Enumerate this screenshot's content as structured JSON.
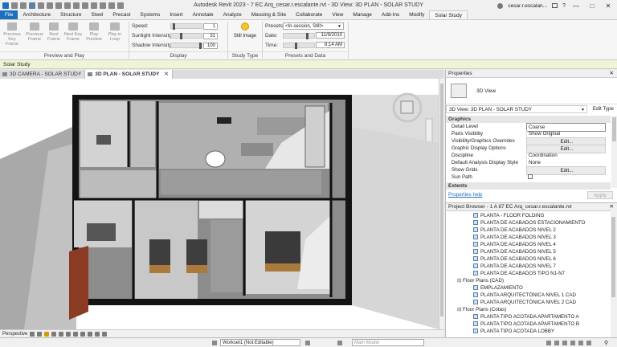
{
  "window": {
    "title": "Autodesk Revit 2023 - 7 EC Arq_cesar.r.escalante.rvt - 3D View: 3D PLAN - SOLAR STUDY",
    "user": "cesar.r.escalan...",
    "minimize": "—",
    "maximize": "□",
    "close": "✕"
  },
  "ribbon_tabs": [
    "File",
    "Architecture",
    "Structure",
    "Steel",
    "Precast",
    "Systems",
    "Insert",
    "Annotate",
    "Analyze",
    "Massing & Site",
    "Collaborate",
    "View",
    "Manage",
    "Add-Ins",
    "Modify",
    "Solar Study"
  ],
  "ribbon": {
    "play_buttons": [
      {
        "label": "Previous Key Frame"
      },
      {
        "label": "Previous Frame"
      },
      {
        "label": "Next Frame"
      },
      {
        "label": "Next Key Frame"
      },
      {
        "label": "Play Preview"
      },
      {
        "label": "Play in Loop"
      }
    ],
    "panel_preview": "Preview and Play",
    "display": {
      "speed_label": "Speed:",
      "speed_value": "1",
      "speed_level": 0.05,
      "sunlight_label": "Sunlight Intensity:",
      "sunlight_value": "31",
      "sunlight_level": 0.31,
      "shadow_label": "Shadow Intensity:",
      "shadow_value": "100",
      "shadow_level": 1.0
    },
    "panel_display": "Display",
    "still_image": "Still Image",
    "panel_study_type": "Study Type",
    "presets_label": "Presets:",
    "presets_value": "<In-session, Still>",
    "date_label": "Date:",
    "date_value": "11/9/2010",
    "time_label": "Time:",
    "time_value": "8:14 AM",
    "panel_presets": "Presets and Data"
  },
  "options_bar": {
    "text": "Solar Study"
  },
  "view_tabs": [
    {
      "label": "3D CAMERA - SOLAR STUDY",
      "active": false
    },
    {
      "label": "3D PLAN - SOLAR STUDY",
      "active": true
    }
  ],
  "view_control_bar": {
    "scale": "Perspective"
  },
  "status_bar": {
    "workset": "Workset1 (Not Editable)",
    "design_option": "Main Model"
  },
  "properties": {
    "title": "Properties",
    "type_name": "3D View",
    "instance_selector": "3D View: 3D PLAN - SOLAR STUDY",
    "edit_type": "Edit Type",
    "sections": {
      "graphics": "Graphics",
      "extents": "Extents"
    },
    "rows": [
      {
        "key": "Detail Level",
        "value": "Coarse",
        "kind": "input"
      },
      {
        "key": "Parts Visibility",
        "value": "Show Original",
        "kind": "text"
      },
      {
        "key": "Visibility/Graphics Overrides",
        "value": "Edit...",
        "kind": "button"
      },
      {
        "key": "Graphic Display Options",
        "value": "Edit...",
        "kind": "button"
      },
      {
        "key": "Discipline",
        "value": "Coordination",
        "kind": "text"
      },
      {
        "key": "Default Analysis Display Style",
        "value": "None",
        "kind": "text"
      },
      {
        "key": "Show Grids",
        "value": "Edit...",
        "kind": "button"
      },
      {
        "key": "Sun Path",
        "value": "",
        "kind": "checkbox"
      }
    ],
    "help_link": "Properties help",
    "apply": "Apply"
  },
  "project_browser": {
    "title": "Project Browser - 1 A 87 EC Arq_cesar.r.escalante.rvt",
    "items_top": [
      "PLANTA - FLOOR FOLDING",
      "PLANTA DE ACABADOS ESTACIONAMIENTO",
      "PLANTA DE ACABADOS NIVEL 2",
      "PLANTA DE ACABADOS NIVEL 3",
      "PLANTA DE ACABADOS NIVEL 4",
      "PLANTA DE ACABADOS NIVEL 5",
      "PLANTA DE ACABADOS NIVEL 6",
      "PLANTA DE ACABADOS NIVEL 7",
      "PLANTA DE ACABADOS TIPO N1-N7"
    ],
    "cat_cad": "Floor Plans (CAD)",
    "items_cad": [
      "EMPLAZAMIENTO",
      "PLANTA ARQUITECTÓNICA NIVEL 1 CAD",
      "PLANTA ARQUITECTÓNICA NIVEL 2 CAD"
    ],
    "cat_cotas": "Floor Plans (Cotas)",
    "items_cotas": [
      "PLANTA TIPO ACOTADA APARTAMENTO A",
      "PLANTA TIPO ACOTADA APARTAMENTO B",
      "PLANTA TIPO ACOTADA LOBBY"
    ]
  },
  "colors": {
    "file_tab": "#1c6fbf",
    "options_bar": "#eef4d4",
    "selection": "#cde3f7"
  }
}
